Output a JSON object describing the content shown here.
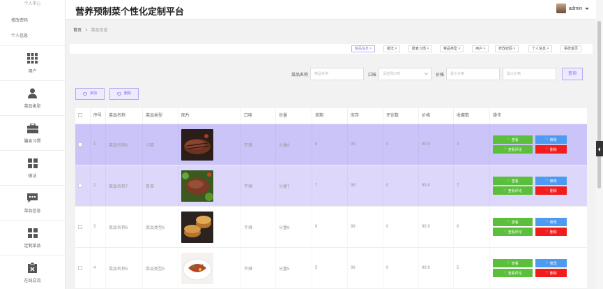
{
  "app": {
    "title": "营养预制菜个性化定制平台"
  },
  "user": {
    "name": "admin"
  },
  "sidebar": {
    "top_label": "个人中心",
    "links": [
      "修改密码",
      "个人信息"
    ],
    "items": [
      {
        "label": "用户",
        "icon": "grid-icon"
      },
      {
        "label": "菜品类型",
        "icon": "person-icon"
      },
      {
        "label": "膳食习惯",
        "icon": "briefcase-icon"
      },
      {
        "label": "做法",
        "icon": "grid-icon"
      },
      {
        "label": "菜品信息",
        "icon": "chat-icon"
      },
      {
        "label": "定制菜品",
        "icon": "grid-icon"
      },
      {
        "label": "在线交流",
        "icon": "clipboard-icon"
      }
    ]
  },
  "breadcrumb": {
    "home": "首页",
    "separator": ">",
    "current": "菜品信息"
  },
  "tags": [
    "菜品信息 ×",
    "做法 ×",
    "膳食习惯 ×",
    "菜品类型 ×",
    "用户 ×",
    "修改密码 ×",
    "个人信息 ×",
    "系统首页"
  ],
  "search": {
    "name_label": "菜品名称",
    "name_placeholder": "菜品名称",
    "taste_label": "口味",
    "taste_placeholder": "请选择口味",
    "price_label": "价格",
    "min_placeholder": "最小价格",
    "max_placeholder": "最大价格",
    "button": "查询"
  },
  "actions": {
    "add": "添加",
    "delete": "删除"
  },
  "table": {
    "columns": [
      "",
      "序号",
      "菜品名称",
      "菜品类型",
      "图片",
      "口味",
      "份量",
      "单期",
      "库存",
      "评论数",
      "价格",
      "收藏数",
      "操作"
    ],
    "rows": [
      {
        "index": "1",
        "name": "菜品名称8",
        "type": "川菜",
        "taste": "不辣",
        "portion": "分量8",
        "period": "8",
        "stock": "99",
        "comments": "0",
        "price": "99.9",
        "favorites": "9"
      },
      {
        "index": "2",
        "name": "菜品名称7",
        "type": "鲁菜",
        "taste": "不辣",
        "portion": "分量7",
        "period": "7",
        "stock": "99",
        "comments": "0",
        "price": "99.9",
        "favorites": "7"
      },
      {
        "index": "3",
        "name": "菜品名称6",
        "type": "菜品类型6",
        "taste": "不辣",
        "portion": "分量6",
        "period": "6",
        "stock": "99",
        "comments": "0",
        "price": "99.9",
        "favorites": "6"
      },
      {
        "index": "4",
        "name": "菜品名称5",
        "type": "菜品类型5",
        "taste": "不辣",
        "portion": "分量5",
        "period": "5",
        "stock": "99",
        "comments": "0",
        "price": "99.9",
        "favorites": "5"
      }
    ],
    "ops": {
      "view": "查看",
      "edit": "修改",
      "view_comments": "查看评论",
      "delete": "删除"
    }
  },
  "colors": {
    "accent": "#7b6fd6",
    "row_selected": "#cbc4f8",
    "green": "#5bbf3b",
    "blue": "#4d9bf0",
    "red": "#f11c1c"
  }
}
